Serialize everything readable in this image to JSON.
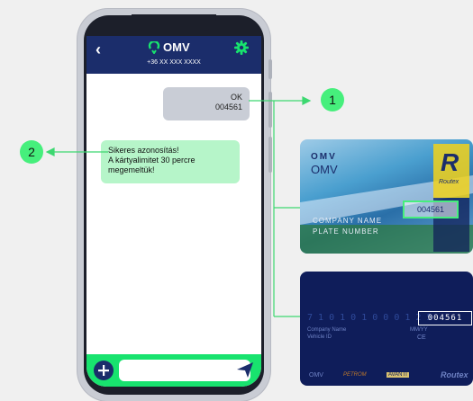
{
  "chat": {
    "contact_name": "OMV",
    "contact_number": "+36 XX XXX XXXX",
    "messages": [
      {
        "direction": "out",
        "lines": [
          "OK",
          "004561"
        ]
      },
      {
        "direction": "in",
        "lines": [
          "Sikeres azonosítás!",
          "A kártyalimitet 30 percre",
          "megemeltük!"
        ]
      }
    ]
  },
  "markers": {
    "one": "1",
    "two": "2"
  },
  "card_front": {
    "brand_logo": "OMV",
    "brand_name": "OMV",
    "highlighted_code": "004561",
    "partner_logo": "R",
    "partner_name": "Routex",
    "lines": [
      "COMPANY NAME",
      "PLATE NUMBER"
    ]
  },
  "card_back": {
    "card_number": "7 1 0 1 0 1 0 0 0 1 2 5",
    "highlighted_code": "004561",
    "field_company": "Company Name",
    "field_vehicle": "Vehicle ID",
    "expiry_label": "MM/YY",
    "ce_mark": "CE",
    "footer_brands": [
      "OMV",
      "PETROM",
      "AVANTI",
      "Routex"
    ]
  },
  "colors": {
    "accent_green": "#46ef7c",
    "header_navy": "#1b2d6b",
    "composer_green": "#18e36e"
  }
}
